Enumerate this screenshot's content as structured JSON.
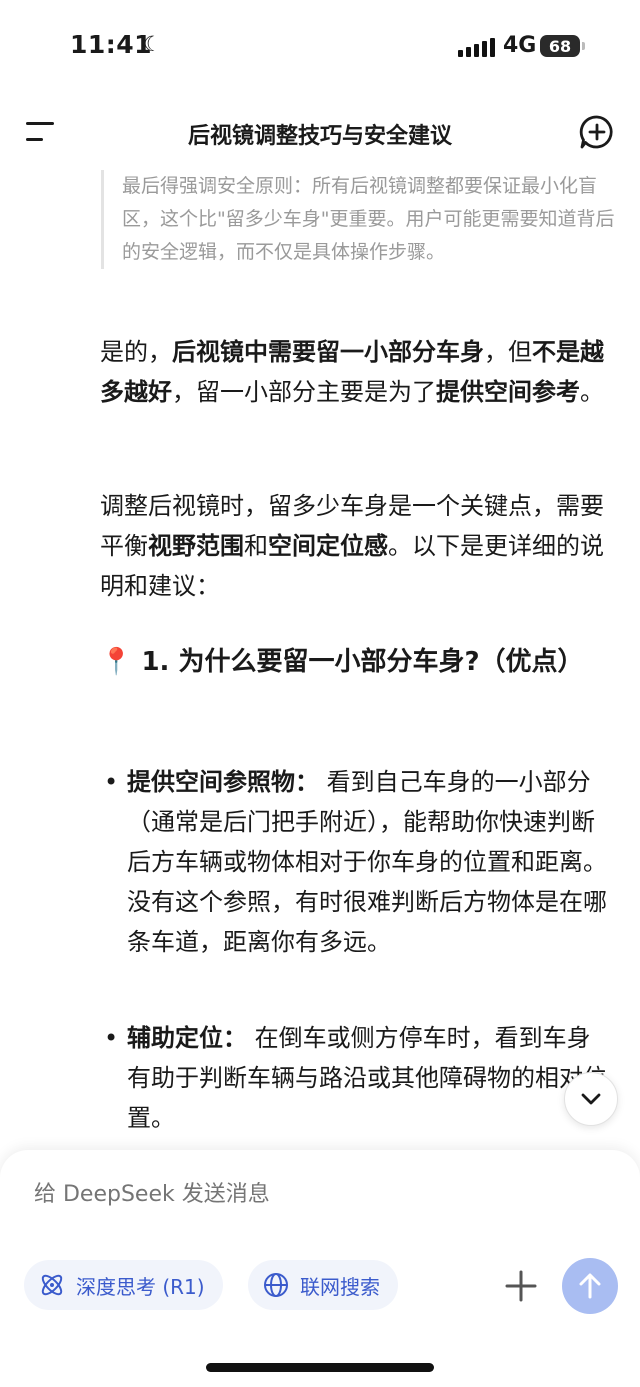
{
  "status_bar": {
    "time": "11:41",
    "network": "4G",
    "battery": "68",
    "moon_icon": "moon-icon"
  },
  "header": {
    "title": "后视镜调整技巧与安全建议",
    "menu_icon": "menu-icon",
    "new_chat_icon": "new-chat-icon"
  },
  "thinking": {
    "text": "最后得强调安全原则：所有后视镜调整都要保证最小化盲区，这个比\"留多少车身\"更重要。用户可能更需要知道背后的安全逻辑，而不仅是具体操作步骤。"
  },
  "answer": {
    "p1": {
      "s1": "是的，",
      "b1": "后视镜中需要留一小部分车身",
      "s2": "，但",
      "b2": "不是越多越好",
      "s3": "，留一小部分主要是为了",
      "b3": "提供空间参考",
      "s4": "。"
    },
    "p2": {
      "s1": "调整后视镜时，留多少车身是一个关键点，需要平衡",
      "b1": "视野范围",
      "s2": "和",
      "b2": "空间定位感",
      "s3": "。以下是更详细的说明和建议："
    },
    "heading": {
      "emoji": "📍",
      "text": "1. 为什么要留一小部分车身?（优点）"
    },
    "bullets": [
      {
        "title": "提供空间参照物：",
        "text": " 看到自己车身的一小部分（通常是后门把手附近），能帮助你快速判断后方车辆或物体相对于你车身的位置和距离。没有这个参照，有时很难判断后方物体是在哪条车道，距离你有多远。"
      },
      {
        "title": "辅助定位：",
        "text": " 在倒车或侧方停车时，看到车身有助于判断车辆与路沿或其他障碍物的相对位置。"
      }
    ],
    "bullet_dot": "•"
  },
  "composer": {
    "placeholder": "给 DeepSeek 发送消息",
    "deep_think_label": "深度思考 (R1)",
    "web_search_label": "联网搜索",
    "accent_color": "#3b5bcc",
    "send_color": "#a9bdf2"
  }
}
